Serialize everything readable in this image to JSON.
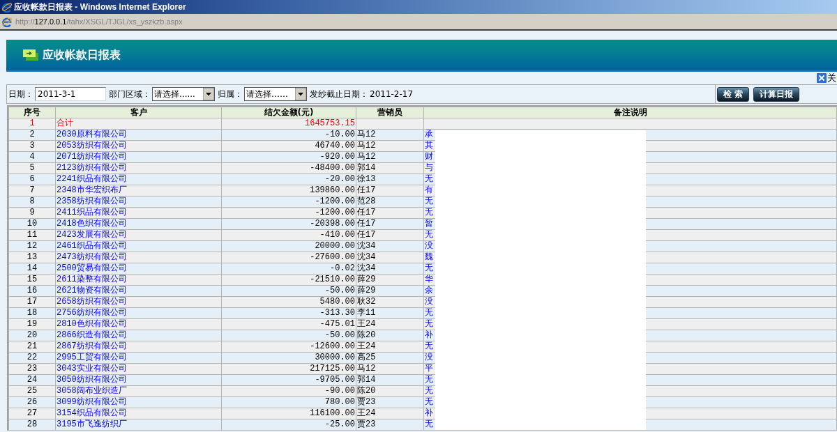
{
  "window": {
    "title": "应收帐款日报表 - Windows Internet Explorer"
  },
  "address_bar": {
    "url": "http://**127.0.0.1**/tahx/XSGL/TJGL/xs_yszkzb.aspx"
  },
  "page_header": {
    "title": "应收帐款日报表"
  },
  "close_link": {
    "label": "关"
  },
  "filters": [
    {
      "kind": "input",
      "label": "日期：",
      "value": "2011-3-1"
    },
    {
      "kind": "select",
      "label": "部门区域：",
      "value": "请选择......"
    },
    {
      "kind": "select",
      "label": "归属：",
      "value": "请选择……"
    },
    {
      "kind": "text",
      "label": "发纱截止日期：",
      "value": "2011-2-17"
    }
  ],
  "buttons": [
    {
      "label": "检 索"
    },
    {
      "label": "计算日报"
    }
  ],
  "table": {
    "columns": [
      "序号",
      "客户",
      "结欠金额(元)",
      "营销员",
      "备注说明"
    ],
    "remarks_redacted": true,
    "rows": [
      {
        "kind": "total",
        "no": "1",
        "customer": "合计",
        "amount": "1645753.15"
      },
      {
        "kind": "entry",
        "no": "2",
        "customer": "2030原料有限公司",
        "amount": "-10.00",
        "salesperson": "马12",
        "remark": "承"
      },
      {
        "kind": "entry",
        "no": "3",
        "customer": "2053纺织有限公司",
        "amount": "46740.00",
        "salesperson": "马12",
        "remark": "其"
      },
      {
        "kind": "entry",
        "no": "4",
        "customer": "2071纺织有限公司",
        "amount": "-920.00",
        "salesperson": "马12",
        "remark": "财"
      },
      {
        "kind": "entry",
        "no": "5",
        "customer": "2123纺织有限公司",
        "amount": "-48400.00",
        "salesperson": "郭14",
        "remark": "与"
      },
      {
        "kind": "entry",
        "no": "6",
        "customer": "2241织品有限公司",
        "amount": "-20.00",
        "salesperson": "徐13",
        "remark": "无"
      },
      {
        "kind": "entry",
        "no": "7",
        "customer": "2348市华宏织布厂",
        "amount": "139860.00",
        "salesperson": "任17",
        "remark": "有"
      },
      {
        "kind": "entry",
        "no": "8",
        "customer": "2358纺织有限公司",
        "amount": "-1200.00",
        "salesperson": "范28",
        "remark": "无"
      },
      {
        "kind": "entry",
        "no": "9",
        "customer": "2411织品有限公司",
        "amount": "-1200.00",
        "salesperson": "任17",
        "remark": "无"
      },
      {
        "kind": "entry",
        "no": "10",
        "customer": "2418色织有限公司",
        "amount": "-20398.00",
        "salesperson": "任17",
        "remark": "暂"
      },
      {
        "kind": "entry",
        "no": "11",
        "customer": "2423发展有限公司",
        "amount": "-410.00",
        "salesperson": "任17",
        "remark": "无"
      },
      {
        "kind": "entry",
        "no": "12",
        "customer": "2461织品有限公司",
        "amount": "20000.00",
        "salesperson": "沈34",
        "remark": "没"
      },
      {
        "kind": "entry",
        "no": "13",
        "customer": "2473纺织有限公司",
        "amount": "-27600.00",
        "salesperson": "沈34",
        "remark": "魏"
      },
      {
        "kind": "entry",
        "no": "14",
        "customer": "2500贸易有限公司",
        "amount": "-0.02",
        "salesperson": "沈34",
        "remark": "无"
      },
      {
        "kind": "entry",
        "no": "15",
        "customer": "2611染整有限公司",
        "amount": "-21510.00",
        "salesperson": "薛29",
        "remark": "华"
      },
      {
        "kind": "entry",
        "no": "16",
        "customer": "2621物资有限公司",
        "amount": "-50.00",
        "salesperson": "薛29",
        "remark": "余"
      },
      {
        "kind": "entry",
        "no": "17",
        "customer": "2658纺织有限公司",
        "amount": "5480.00",
        "salesperson": "耿32",
        "remark": "没"
      },
      {
        "kind": "entry",
        "no": "18",
        "customer": "2756纺织有限公司",
        "amount": "-313.30",
        "salesperson": "李11",
        "remark": "无"
      },
      {
        "kind": "entry",
        "no": "19",
        "customer": "2810色织有限公司",
        "amount": "-475.01",
        "salesperson": "王24",
        "remark": "无"
      },
      {
        "kind": "entry",
        "no": "20",
        "customer": "2866织造有限公司",
        "amount": "-50.00",
        "salesperson": "陈20",
        "remark": "补"
      },
      {
        "kind": "entry",
        "no": "21",
        "customer": "2867纺织有限公司",
        "amount": "-12600.00",
        "salesperson": "王24",
        "remark": "无"
      },
      {
        "kind": "entry",
        "no": "22",
        "customer": "2995工贸有限公司",
        "amount": "30000.00",
        "salesperson": "高25",
        "remark": "没"
      },
      {
        "kind": "entry",
        "no": "23",
        "customer": "3043实业有限公司",
        "amount": "217125.00",
        "salesperson": "马12",
        "remark": "平"
      },
      {
        "kind": "entry",
        "no": "24",
        "customer": "3050纺织有限公司",
        "amount": "-9705.00",
        "salesperson": "郭14",
        "remark": "无"
      },
      {
        "kind": "entry",
        "no": "25",
        "customer": "3058阔布业织造厂",
        "amount": "-90.00",
        "salesperson": "陈20",
        "remark": "无"
      },
      {
        "kind": "entry",
        "no": "26",
        "customer": "3099纺织有限公司",
        "amount": "780.00",
        "salesperson": "贾23",
        "remark": "无"
      },
      {
        "kind": "entry",
        "no": "27",
        "customer": "3154织品有限公司",
        "amount": "116100.00",
        "salesperson": "王24",
        "remark": "补"
      },
      {
        "kind": "entry",
        "no": "28",
        "customer": "3195市飞逸纺织厂",
        "amount": "-25.00",
        "salesperson": "贾23",
        "remark": "无"
      }
    ]
  }
}
